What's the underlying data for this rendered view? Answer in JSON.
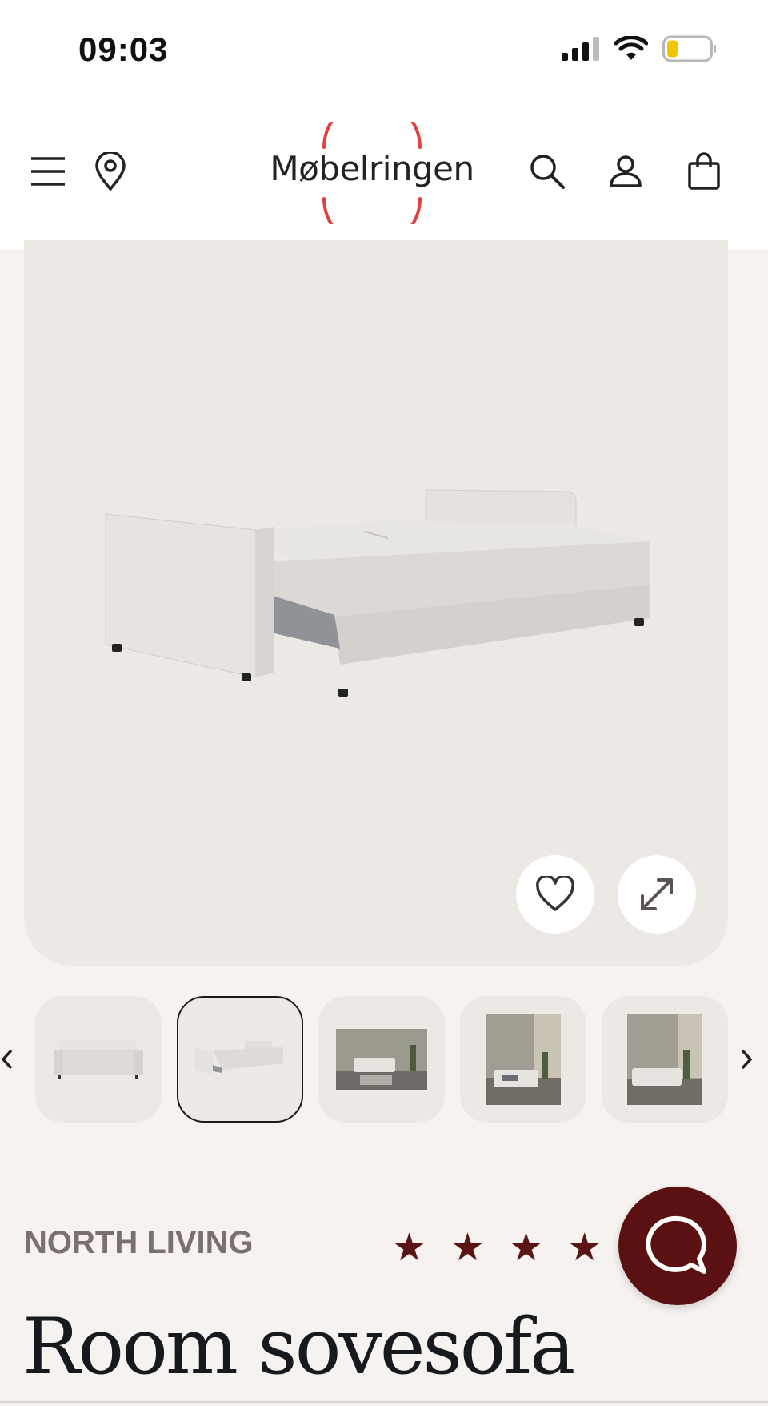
{
  "status_bar": {
    "time": "09:03"
  },
  "header": {
    "logo_text": "Møbelringen",
    "icons": [
      "menu-icon",
      "location-pin-icon",
      "search-icon",
      "account-icon",
      "shopping-bag-icon"
    ]
  },
  "gallery": {
    "product_image": "sofa-bed-image",
    "actions": [
      "heart-icon",
      "expand-icon"
    ]
  },
  "thumbnails": {
    "items": [
      "sofa",
      "sofa-bed",
      "living-room-1",
      "living-room-2",
      "living-room-3"
    ],
    "active_index": 1
  },
  "product": {
    "brand": "NORTH LIVING",
    "rating_stars": [
      "★",
      "★",
      "★",
      "★"
    ],
    "title": "Room sovesofa"
  },
  "colors": {
    "accent": "#5b1111",
    "logo_ring": "#e24040",
    "background": "#f5f2ef",
    "gallery_bg": "#ece8e4"
  }
}
